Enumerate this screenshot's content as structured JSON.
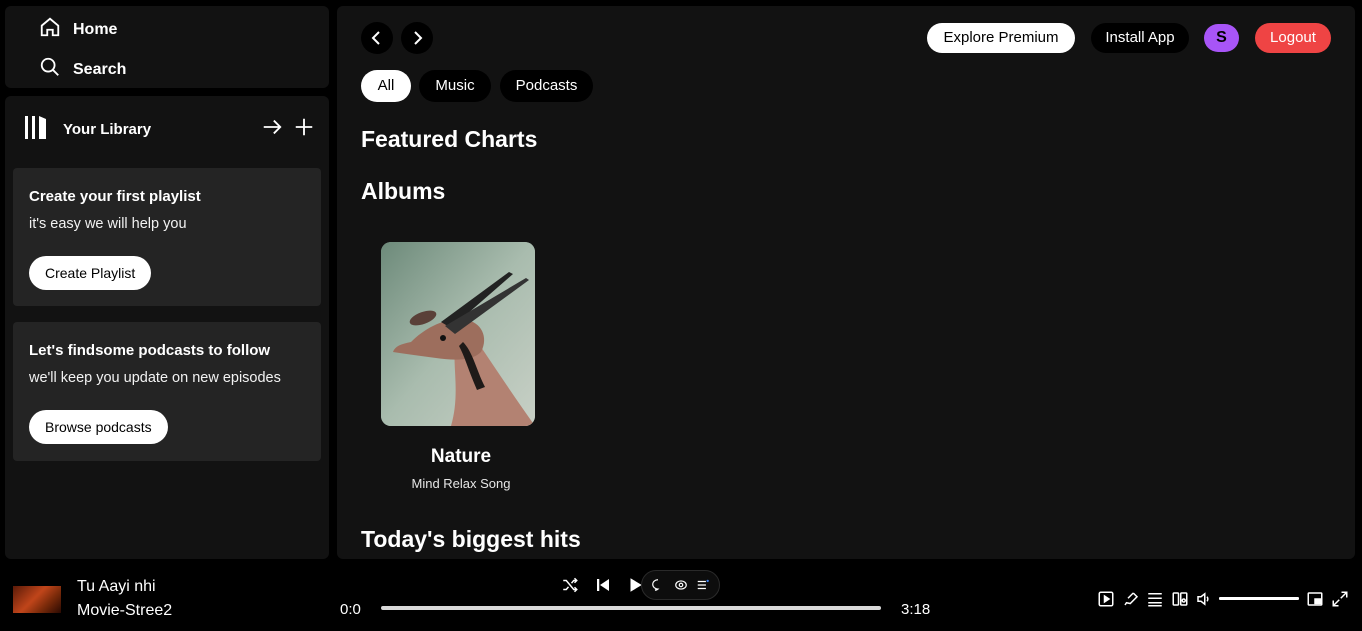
{
  "nav": {
    "home": "Home",
    "search": "Search"
  },
  "library": {
    "title": "Your Library",
    "card1": {
      "title": "Create your first playlist",
      "subtitle": "it's easy we will help you",
      "button": "Create Playlist"
    },
    "card2": {
      "title": "Let's findsome podcasts to follow",
      "subtitle": "we'll keep you update on new episodes",
      "button": "Browse podcasts"
    }
  },
  "header": {
    "explore": "Explore Premium",
    "install": "Install App",
    "avatar": "S",
    "logout": "Logout"
  },
  "chips": [
    "All",
    "Music",
    "Podcasts"
  ],
  "sections": {
    "featured": "Featured Charts",
    "albums": "Albums",
    "hits": "Today's biggest hits"
  },
  "album": {
    "title": "Nature",
    "subtitle": "Mind Relax Song"
  },
  "player": {
    "song": "Tu Aayi nhi",
    "artist": "Movie-Stree2",
    "current_time": "0:0",
    "total_time": "3:18",
    "progress": 0,
    "volume": 1
  },
  "colors": {
    "accent_purple": "#a855f7",
    "logout_red": "#ef4444",
    "panel": "#121212",
    "card": "#242424"
  }
}
